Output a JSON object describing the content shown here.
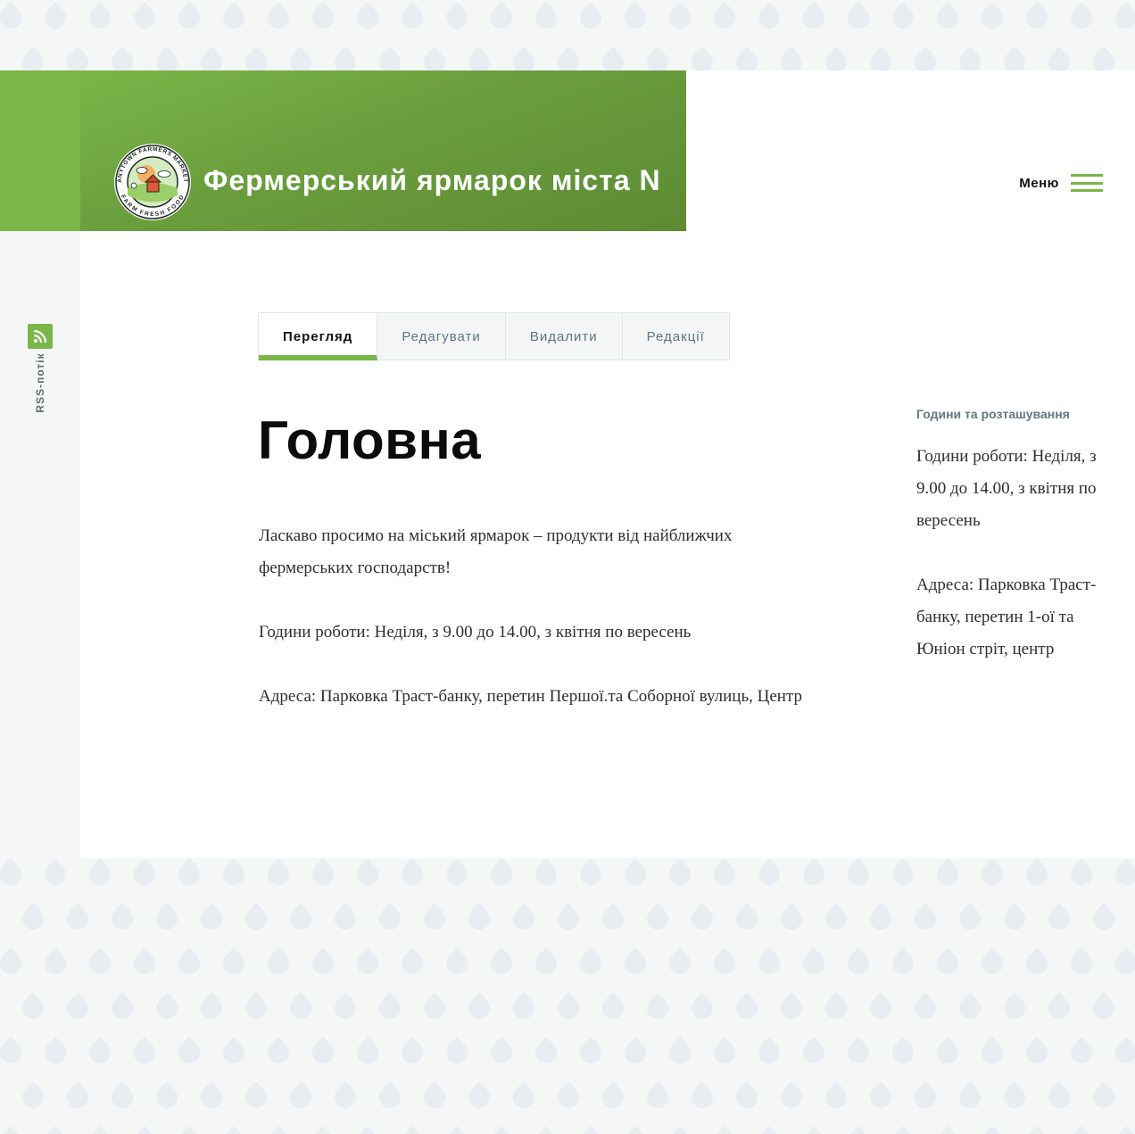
{
  "header": {
    "site_name": "Фермерський ярмарок міста N",
    "logo_text_top": "ANYTOWN FARMERS MARKET",
    "logo_text_bottom": "FARM FRESH FOOD",
    "menu_label": "Меню"
  },
  "sidebar": {
    "rss_label": "RSS-потік",
    "rss_icon": "rss-icon"
  },
  "tabs": [
    {
      "label": "Перегляд",
      "active": true
    },
    {
      "label": "Редагувати",
      "active": false
    },
    {
      "label": "Видалити",
      "active": false
    },
    {
      "label": "Редакції",
      "active": false
    }
  ],
  "content": {
    "title": "Головна",
    "paragraphs": [
      "Ласкаво просимо на міський ярмарок – продукти від найближчих фермерських господарств!",
      "Години роботи: Неділя, з 9.00 до 14.00, з квітня по вересень",
      "Адреса: Парковка Траст-банку, перетин Першої.та Соборної вулиць, Центр"
    ]
  },
  "aside": {
    "title": "Години та розташування",
    "paragraphs": [
      "Години роботи: Неділя, з 9.00 до 14.00, з квітня по вересень",
      "Адреса: Парковка Траст-банку, перетин 1-ої та Юніон стріт, центр"
    ]
  },
  "colors": {
    "accent": "#7ab648",
    "pattern_drop": "#e7edf1",
    "background": "#f5f7f6"
  }
}
